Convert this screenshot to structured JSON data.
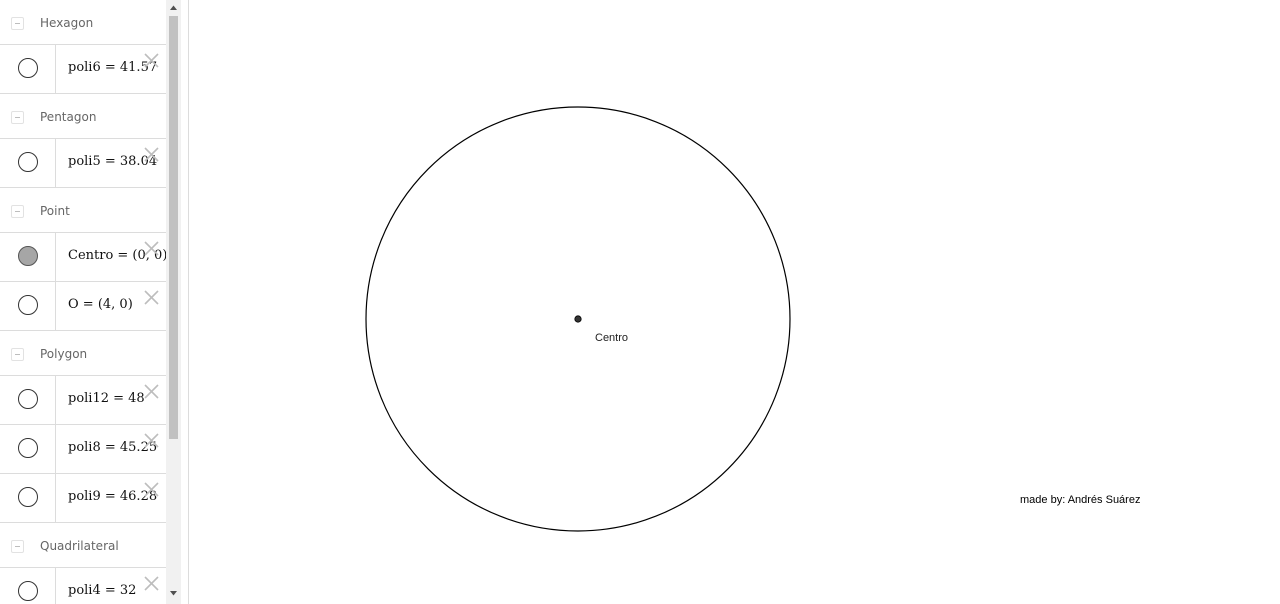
{
  "algebra": {
    "groups": [
      {
        "label": "Hexagon",
        "items": [
          {
            "text": "poli6 = 41.57",
            "visible": false
          }
        ]
      },
      {
        "label": "Pentagon",
        "items": [
          {
            "text": "poli5 = 38.04",
            "visible": false
          }
        ]
      },
      {
        "label": "Point",
        "items": [
          {
            "text": "Centro = (0, 0)",
            "visible": true
          },
          {
            "text": "O = (4, 0)",
            "visible": false
          }
        ]
      },
      {
        "label": "Polygon",
        "items": [
          {
            "text": "poli12 = 48",
            "visible": false
          },
          {
            "text": "poli8 = 45.25",
            "visible": false
          },
          {
            "text": "poli9 = 46.28",
            "visible": false
          }
        ]
      },
      {
        "label": "Quadrilateral",
        "items": [
          {
            "text": "poli4 = 32",
            "visible": false
          }
        ]
      }
    ]
  },
  "graphics": {
    "point_label": "Centro",
    "credit": "made by: Andrés Suárez"
  },
  "colors": {
    "circle_stroke": "#000000",
    "point_fill": "#333333",
    "visible_toggle_fill": "#a6a6a6",
    "scroll_thumb": "#c1c1c1"
  }
}
